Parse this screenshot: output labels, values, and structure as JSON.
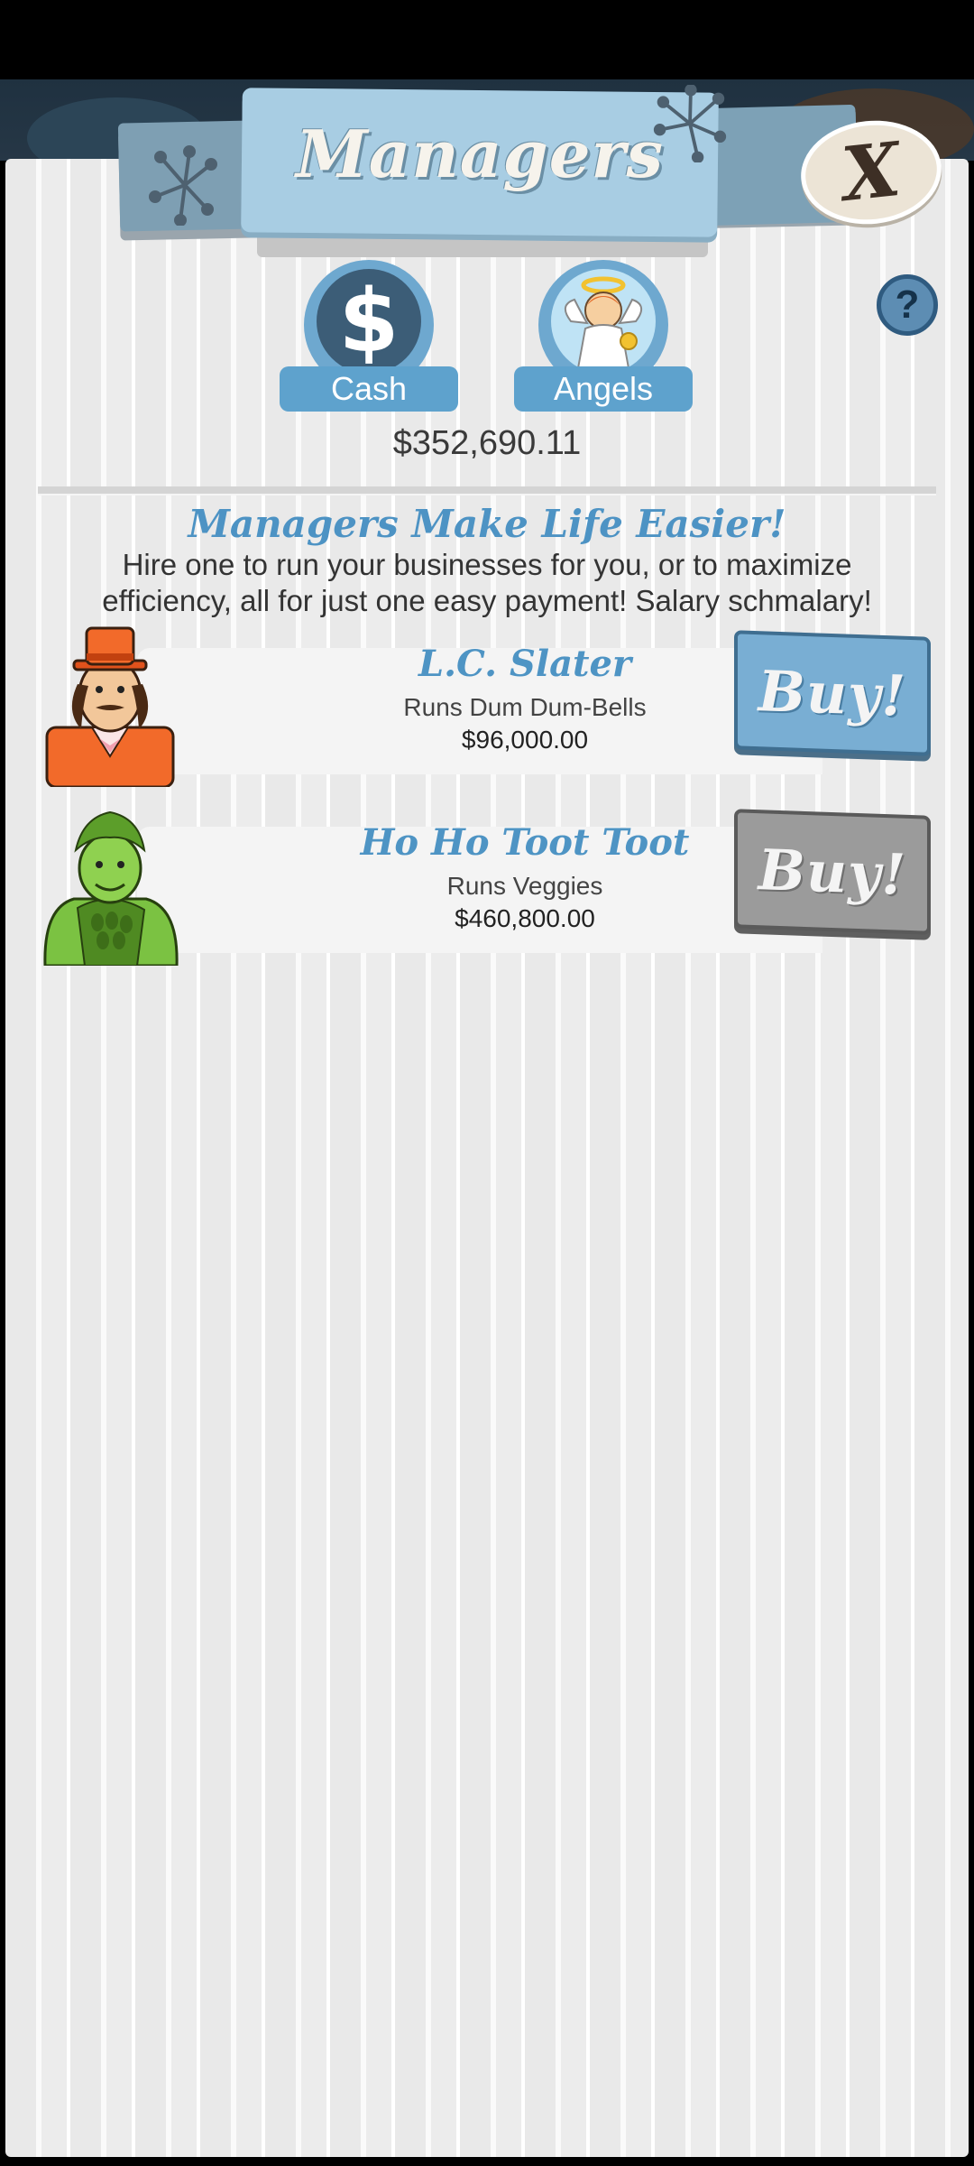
{
  "header": {
    "title": "Managers",
    "close_label": "X",
    "help_label": "?"
  },
  "currency_tabs": [
    {
      "label": "Cash",
      "icon": "dollar-icon",
      "symbol": "$"
    },
    {
      "label": "Angels",
      "icon": "angel-icon"
    }
  ],
  "cash_amount": "$352,690.11",
  "intro": {
    "heading": "Managers Make Life Easier!",
    "text": "Hire one to run your businesses for you, or to maximize efficiency, all for just one easy payment! Salary schmalary!"
  },
  "managers": [
    {
      "name": "L.C. Slater",
      "runs": "Runs Dum Dum-Bells",
      "cost": "$96,000.00",
      "buy_label": "Buy!",
      "affordable": true,
      "portrait": "slater-portrait"
    },
    {
      "name": "Ho Ho Toot Toot",
      "runs": "Runs Veggies",
      "cost": "$460,800.00",
      "buy_label": "Buy!",
      "affordable": false,
      "portrait": "green-giant-portrait"
    }
  ],
  "colors": {
    "accent_blue": "#4e94c4",
    "header_blue": "#a8cde3",
    "buy_enabled": "#79aed3",
    "buy_disabled": "#9b9b9b"
  }
}
